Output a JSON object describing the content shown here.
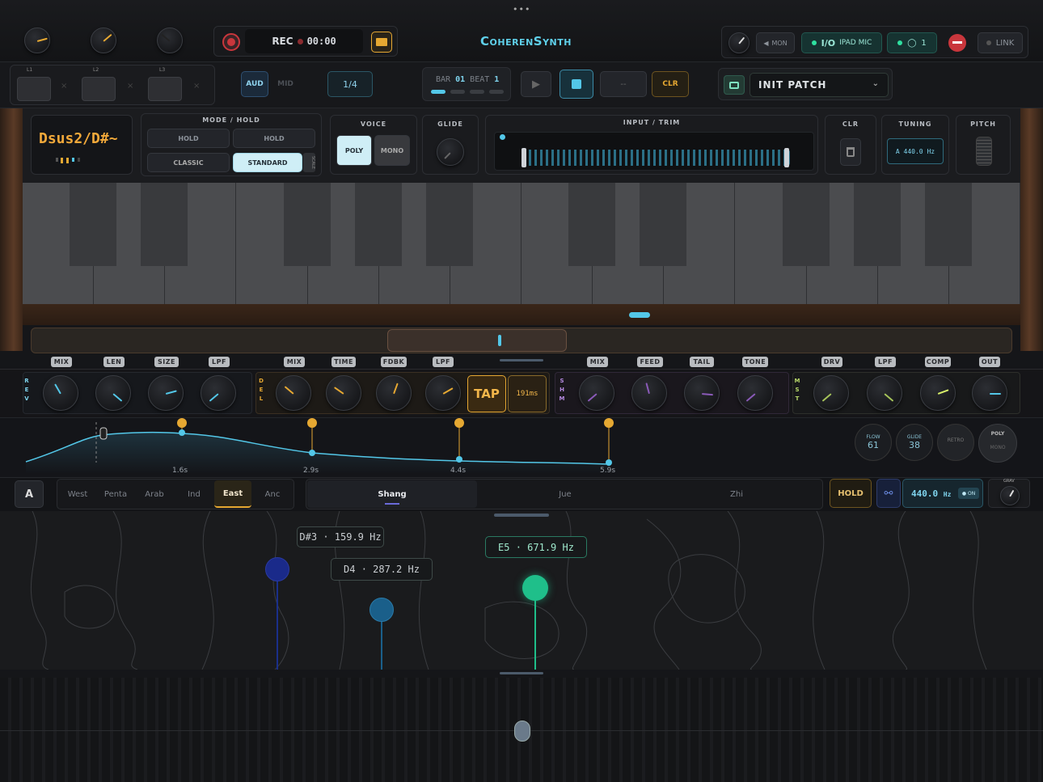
{
  "app": {
    "title": "CoherenSynth",
    "rec_label": "REC",
    "rec_time": "00:00"
  },
  "top_right": {
    "mon": "MON",
    "io": "I/O",
    "io_src": "IPAD MIC",
    "count": "1",
    "link": "LINK"
  },
  "loops": [
    "L1",
    "L2",
    "L3"
  ],
  "row2": {
    "aud": "AUD",
    "mid": "MID",
    "quant": "1/4",
    "bar_label": "BAR",
    "bar": "01",
    "beat_label": "BEAT",
    "beat": "1",
    "dash": "--",
    "clr": "CLR",
    "patch": "INIT PATCH"
  },
  "chord": "Dsus2/D#~",
  "mode": {
    "title": "MODE / HOLD",
    "hold1": "HOLD",
    "hold2": "HOLD",
    "classic": "CLASSIC",
    "standard": "STANDARD",
    "scale": "SCALE"
  },
  "voice": {
    "title": "VOICE",
    "poly": "POLY",
    "mono": "MONO"
  },
  "glide": {
    "title": "GLIDE"
  },
  "input": {
    "title": "INPUT / TRIM"
  },
  "clr_title": "CLR",
  "tuning": {
    "title": "TUNING",
    "value": "A 440.0 Hz"
  },
  "pitch": {
    "title": "PITCH"
  },
  "fx": {
    "rev": "R E V",
    "del": "D E L",
    "shm": "S H M",
    "mst": "M S T",
    "labels": [
      "MIX",
      "LEN",
      "SIZE",
      "LPF",
      "MIX",
      "TIME",
      "FDBK",
      "LPF",
      "MIX",
      "FEED",
      "TAIL",
      "TONE",
      "DRV",
      "LPF",
      "COMP",
      "OUT"
    ],
    "tap": "TAP",
    "delay_ms": "191ms"
  },
  "envelope": {
    "times": [
      "1.6s",
      "2.9s",
      "4.4s",
      "5.9s"
    ]
  },
  "mini_knobs": {
    "flow_l": "FLOW",
    "flow": "61",
    "glide_l": "GLIDE",
    "glide": "38",
    "retro": "RETRO",
    "poly": "POLY",
    "mono": "MONO"
  },
  "scales": {
    "a": "A",
    "regions": [
      "West",
      "Penta",
      "Arab",
      "Ind",
      "East",
      "Anc"
    ],
    "modes": [
      "Shang",
      "Jue",
      "Zhi"
    ],
    "hold": "HOLD",
    "freq": "440.0",
    "unit": "Hz",
    "on": "ON",
    "grav": "GRAV"
  },
  "notes": [
    {
      "label": "D#3 · 159.9 Hz"
    },
    {
      "label": "D4 · 287.2 Hz"
    },
    {
      "label": "E5 · 671.9 Hz"
    }
  ],
  "colors": {
    "accent": "#e6a832",
    "teal": "#53c7e8",
    "green": "#1fbf8a",
    "blue": "#1a2f8a"
  }
}
